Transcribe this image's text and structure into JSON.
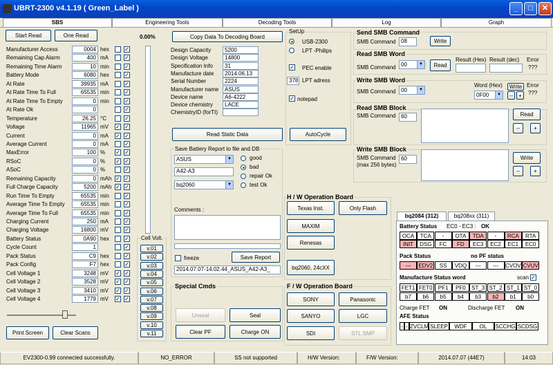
{
  "window": {
    "title": "UBRT-2300 v4.1.19  ( Green_Label )",
    "btn_min": "_",
    "btn_max": "□",
    "btn_close": "✕"
  },
  "tabs": [
    "SBS",
    "Engineering Tools",
    "Decoding Tools",
    "Log",
    "Graph"
  ],
  "left": {
    "start": "Start Read",
    "one": "One Read",
    "percent": "0.00%",
    "print": "Print Screen",
    "clear": "Clear Scans",
    "rows": [
      {
        "n": "Manufacturer Access",
        "v": "0004",
        "u": "hex",
        "c1": false,
        "c2": true
      },
      {
        "n": "Remaining Cap Alarm",
        "v": "400",
        "u": "mA",
        "c1": false,
        "c2": true
      },
      {
        "n": "Remaining Time Alarm",
        "v": "10",
        "u": "min",
        "c1": false,
        "c2": true
      },
      {
        "n": "Battery Mode",
        "v": "6080",
        "u": "hex",
        "c1": false,
        "c2": true
      },
      {
        "n": "At Rate",
        "v": "39935",
        "u": "mA",
        "c1": false,
        "c2": true
      },
      {
        "n": "At Rate Time To Full",
        "v": "65535",
        "u": "min",
        "c1": false,
        "c2": true
      },
      {
        "n": "At Rate Time To Empty",
        "v": "0",
        "u": "min",
        "c1": false,
        "c2": true
      },
      {
        "n": "At Rate Ok",
        "v": "0",
        "u": "",
        "c1": false,
        "c2": true
      },
      {
        "n": "Temperature",
        "v": "26.25",
        "u": "°C",
        "c1": false,
        "c2": true
      },
      {
        "n": "Voltage",
        "v": "11965",
        "u": "mV",
        "c1": true,
        "c2": true
      },
      {
        "n": "Current",
        "v": "0",
        "u": "mA",
        "c1": true,
        "c2": true
      },
      {
        "n": "Average Current",
        "v": "0",
        "u": "mA",
        "c1": false,
        "c2": true
      },
      {
        "n": "MaxError",
        "v": "100",
        "u": "%",
        "c1": true,
        "c2": true
      },
      {
        "n": "RSoC",
        "v": "0",
        "u": "%",
        "c1": true,
        "c2": true
      },
      {
        "n": "ASoC",
        "v": "0",
        "u": "%",
        "c1": false,
        "c2": true
      },
      {
        "n": "Remaining Capacity",
        "v": "0",
        "u": "mAh",
        "c1": true,
        "c2": true
      },
      {
        "n": "Full Charge Capacity",
        "v": "5200",
        "u": "mAh",
        "c1": true,
        "c2": true
      },
      {
        "n": "Run Time To Empty",
        "v": "65535",
        "u": "min",
        "c1": false,
        "c2": true
      },
      {
        "n": "Average Time To Empty",
        "v": "65535",
        "u": "min",
        "c1": false,
        "c2": true
      },
      {
        "n": "Average Time To Full",
        "v": "65535",
        "u": "min",
        "c1": false,
        "c2": true
      },
      {
        "n": "Charging Current",
        "v": "250",
        "u": "mA",
        "c1": false,
        "c2": true
      },
      {
        "n": "Charging Voltage",
        "v": "16800",
        "u": "mV",
        "c1": false,
        "c2": true
      },
      {
        "n": "Battery Status",
        "v": "0A90",
        "u": "hex",
        "c1": false,
        "c2": true
      },
      {
        "n": "Cycle Count",
        "v": "1",
        "u": "",
        "c1": false,
        "c2": true
      },
      {
        "n": "Pack Status",
        "v": "C9",
        "u": "hex",
        "c1": false,
        "c2": true
      },
      {
        "n": "Pack Config",
        "v": "F7",
        "u": "hex",
        "c1": false,
        "c2": true
      },
      {
        "n": "Cell Voltage 1",
        "v": "3248",
        "u": "mV",
        "c1": true,
        "c2": true
      },
      {
        "n": "Cell Voltage 2",
        "v": "3528",
        "u": "mV",
        "c1": true,
        "c2": true
      },
      {
        "n": "Cell Voltage 3",
        "v": "3410",
        "u": "mV",
        "c1": true,
        "c2": true
      },
      {
        "n": "Cell Voltage 4",
        "v": "1779",
        "u": "mV",
        "c1": true,
        "c2": true
      }
    ]
  },
  "cellvolt": {
    "title": "Cell Volt.",
    "items": [
      "v.01",
      "v.02",
      "v.03",
      "v.04",
      "v.05",
      "v.06",
      "v.07",
      "v.08",
      "v.09",
      "v.10",
      "v.11"
    ]
  },
  "static": {
    "copy": "Copy Data To Decoding Board",
    "read": "Read Static Data",
    "rows": [
      {
        "n": "Design Capacity",
        "v": "5200"
      },
      {
        "n": "Design Voltage",
        "v": "14800"
      },
      {
        "n": "Specification Info",
        "v": "31"
      },
      {
        "n": "Manufacture date",
        "v": "2014.06.13"
      },
      {
        "n": "Serial Number",
        "v": "2224"
      },
      {
        "n": "Manufacturer name",
        "v": "ASUS"
      },
      {
        "n": "Device name",
        "v": "A6-4222"
      },
      {
        "n": "Device chemistry",
        "v": "LACE"
      },
      {
        "n": "ChemistryID (forTI)",
        "v": ""
      }
    ]
  },
  "save": {
    "title": "Save Battery Report to file and DB",
    "maker": "ASUS",
    "model": "A42-A3",
    "chip": "bq2060",
    "r_good": "good",
    "r_bad": "bad",
    "r_repair": "repair Ok",
    "r_test": "test  Ok",
    "comments": "Comments :",
    "freeze": "freeze",
    "save_btn": "Save Report",
    "filename": "2014.07.07-14.02.44_ASUS_A42-A3_"
  },
  "special": {
    "title": "Special Cmds",
    "unseal": "Unseal",
    "seal": "Seal",
    "clearpf": "Clear PF",
    "chargeon": "Charge ON"
  },
  "setup": {
    "title": "SetUp",
    "usb": "USB-2300",
    "lpt": "LPT -Philips",
    "pec": "PEC enable",
    "lptaddr": "378",
    "lptaddr_lbl": "LPT adress",
    "notepad": "notepad",
    "autocycle": "AutoCycle"
  },
  "hw": {
    "title": "H / W Operation Board",
    "texas": "Texas Inst.",
    "flash": "Only Flash",
    "maxim": "MAXIM",
    "renesas": "Renesas",
    "bq": "bq2060, 24cXX"
  },
  "fw": {
    "title": "F / W Operation Board",
    "sony": "SONY",
    "panasonic": "Panasonic",
    "sanyo": "SANYO",
    "lgc": "LGC",
    "sdi": "SDI",
    "stl": "STL  SMP"
  },
  "smb": {
    "send_title": "Send SMB Command",
    "cmd_lbl": "SMB Command",
    "send_cmd": "08",
    "write": "Write",
    "rw_title": "Read SMB Word",
    "rw_cmd": "00",
    "read": "Read",
    "res_hex": "Result (Hex)",
    "res_dec": "Result (dec)",
    "error": "Error",
    "err_val": "???",
    "ww_title": "Write SMB Word",
    "ww_cmd": "00",
    "word_hex": "Word (Hex)",
    "word_val": "0F00",
    "minus": "--",
    "plus": "+",
    "rb_title": "Read SMB Block",
    "rb_cmd": "60",
    "wb_title": "Write SMB Block",
    "wb_cmd": "60",
    "max": "(max 256 bytes)"
  },
  "bq": {
    "tab1": "bq2084 (312)",
    "tab2": "bq208xx (311)",
    "bs_title": "Battery Status",
    "bs_ec": "EC0 - EC3 :",
    "bs_ok": "OK",
    "bs_row1": [
      "OCA",
      "TCA",
      "-",
      "OTA",
      "TDA",
      "-",
      "RCA",
      "RTA"
    ],
    "bs_row1_red": [
      false,
      false,
      false,
      false,
      true,
      false,
      true,
      false
    ],
    "bs_row2": [
      "INIT",
      "DSG",
      "FC",
      "FD",
      "EC3",
      "EC2",
      "EC1",
      "EC0"
    ],
    "bs_row2_red": [
      true,
      false,
      false,
      true,
      false,
      false,
      false,
      false
    ],
    "ps_title": "Pack Status",
    "nopf": "no PF status",
    "ps_row": [
      "---",
      "EDV2",
      "SS",
      "VDQ",
      "---",
      "---",
      "CVOV",
      "CVUV"
    ],
    "ps_red": [
      true,
      true,
      false,
      false,
      false,
      false,
      false,
      true
    ],
    "msw_title": "Manufacture Status word",
    "scan": "scan",
    "ms_row1": [
      "FET1",
      "FET0",
      "PF1",
      "PF0",
      "ST_3",
      "ST_2",
      "ST_1",
      "ST_0"
    ],
    "ms_row2": [
      "b7",
      "b6",
      "b5",
      "b4",
      "b3",
      "b2",
      "b1",
      "b0"
    ],
    "ms_red2": [
      false,
      false,
      false,
      false,
      false,
      true,
      false,
      false
    ],
    "cfet": "Charge FET",
    "cfet_v": "ON",
    "dfet": "Discharge FET",
    "dfet_v": "ON",
    "afe_title": "AFE Status",
    "afe_row": [
      "-",
      "-",
      "ZVCLM",
      "SLEEP",
      "WDF",
      "OL",
      "SCCHG",
      "SCDSG"
    ]
  },
  "statusbar": [
    "EV2300-0.99 connected successfully.",
    "NO_ERROR",
    "SS not supported",
    "H/W Version:",
    "F/W Version:",
    "2014.07.07  (44E7)",
    "14:03"
  ],
  "colors": {
    "title_blue": "#0346c8",
    "red_cell": "#f8b4b4",
    "bg": "#ece9d8"
  }
}
